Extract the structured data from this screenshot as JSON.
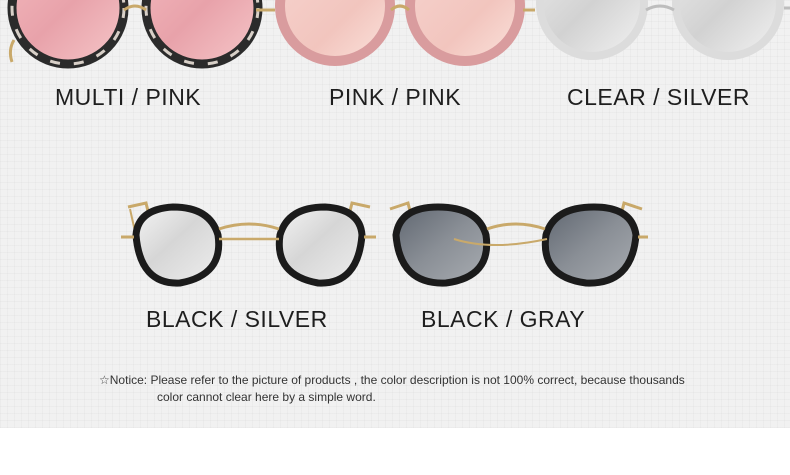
{
  "products": [
    {
      "label": "MULTI / PINK",
      "frame": "multi",
      "lens": "pink"
    },
    {
      "label": "PINK / PINK",
      "frame": "pink",
      "lens": "pink"
    },
    {
      "label": "CLEAR / SILVER",
      "frame": "clear",
      "lens": "silver"
    },
    {
      "label": "BLACK / SILVER",
      "frame": "black",
      "lens": "silver"
    },
    {
      "label": "BLACK / GRAY",
      "frame": "black",
      "lens": "gray"
    }
  ],
  "notice": {
    "star": "☆",
    "prefix": "Notice:",
    "line1": " Please refer to the picture of products , the color description is not 100% correct, because thousands",
    "line2": "color cannot clear here by a simple word."
  },
  "colors": {
    "background": "#f1f1f1",
    "text": "#1e1e1e",
    "gold_metal": "#c9a96a",
    "silver_metal": "#c8c8c8"
  }
}
